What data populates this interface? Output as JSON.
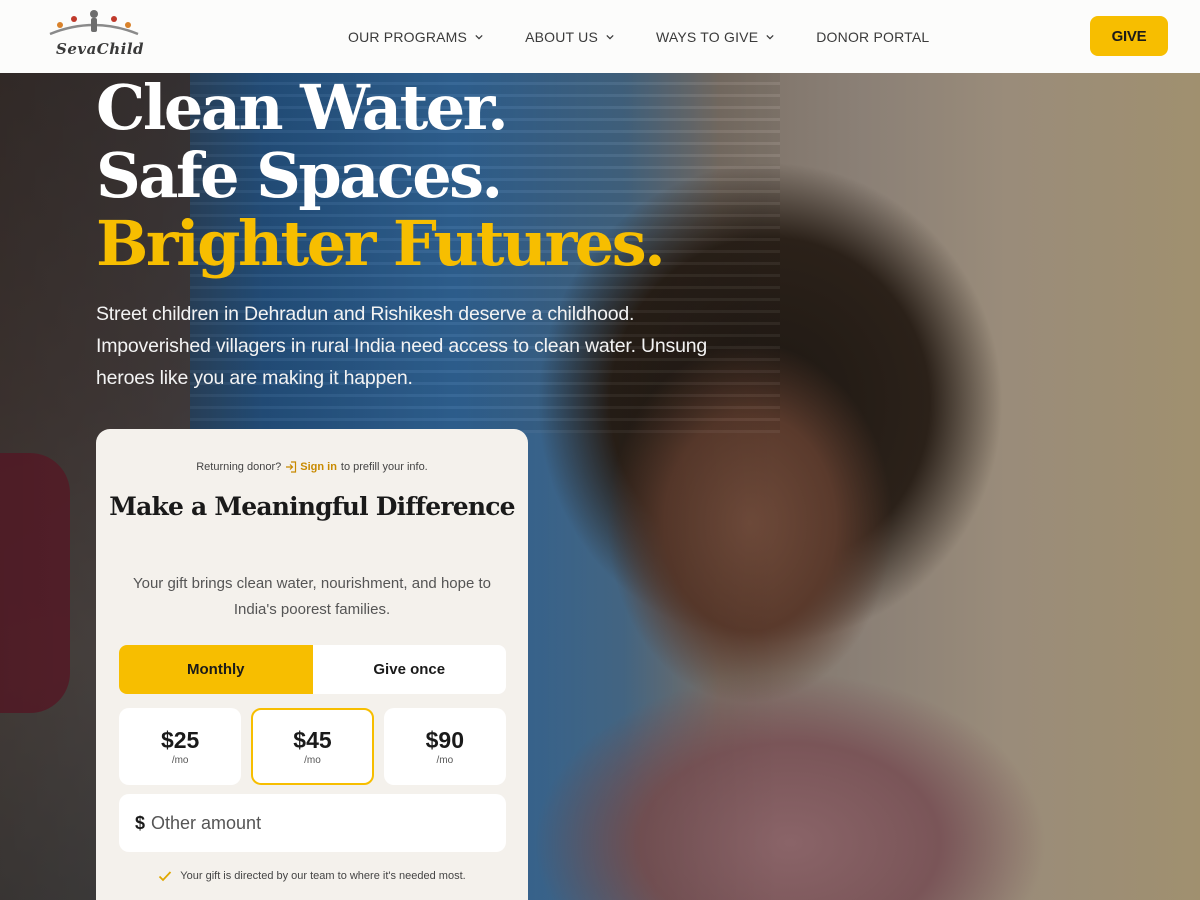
{
  "brand": {
    "name": "SevaChild",
    "accent": "#f7be00"
  },
  "nav": {
    "items": [
      {
        "label": "OUR PROGRAMS",
        "has_dropdown": true
      },
      {
        "label": "ABOUT US",
        "has_dropdown": true
      },
      {
        "label": "WAYS TO GIVE",
        "has_dropdown": true
      },
      {
        "label": "DONOR PORTAL",
        "has_dropdown": false
      }
    ],
    "give_label": "GIVE"
  },
  "hero": {
    "line1": "Clean Water.",
    "line2": "Safe Spaces.",
    "line3": "Brighter Futures.",
    "subtitle": "Street children in Dehradun and Rishikesh deserve a childhood. Impoverished villagers in rural India need access to clean water. Unsung heroes like you are making it happen."
  },
  "donation": {
    "returning_prefix": "Returning donor?",
    "signin_label": "Sign in",
    "returning_suffix": "to prefill your info.",
    "title": "Make a Meaningful Difference",
    "subtitle": "Your gift brings clean water, nourishment, and hope to India's poorest families.",
    "frequency": {
      "monthly": "Monthly",
      "once": "Give once",
      "selected": "Monthly"
    },
    "amounts": [
      {
        "value": "$25",
        "per": "/mo"
      },
      {
        "value": "$45",
        "per": "/mo",
        "selected": true
      },
      {
        "value": "$90",
        "per": "/mo"
      }
    ],
    "other_currency": "$",
    "other_placeholder": "Other amount",
    "note": "Your gift is directed by our team to where it's needed most."
  }
}
